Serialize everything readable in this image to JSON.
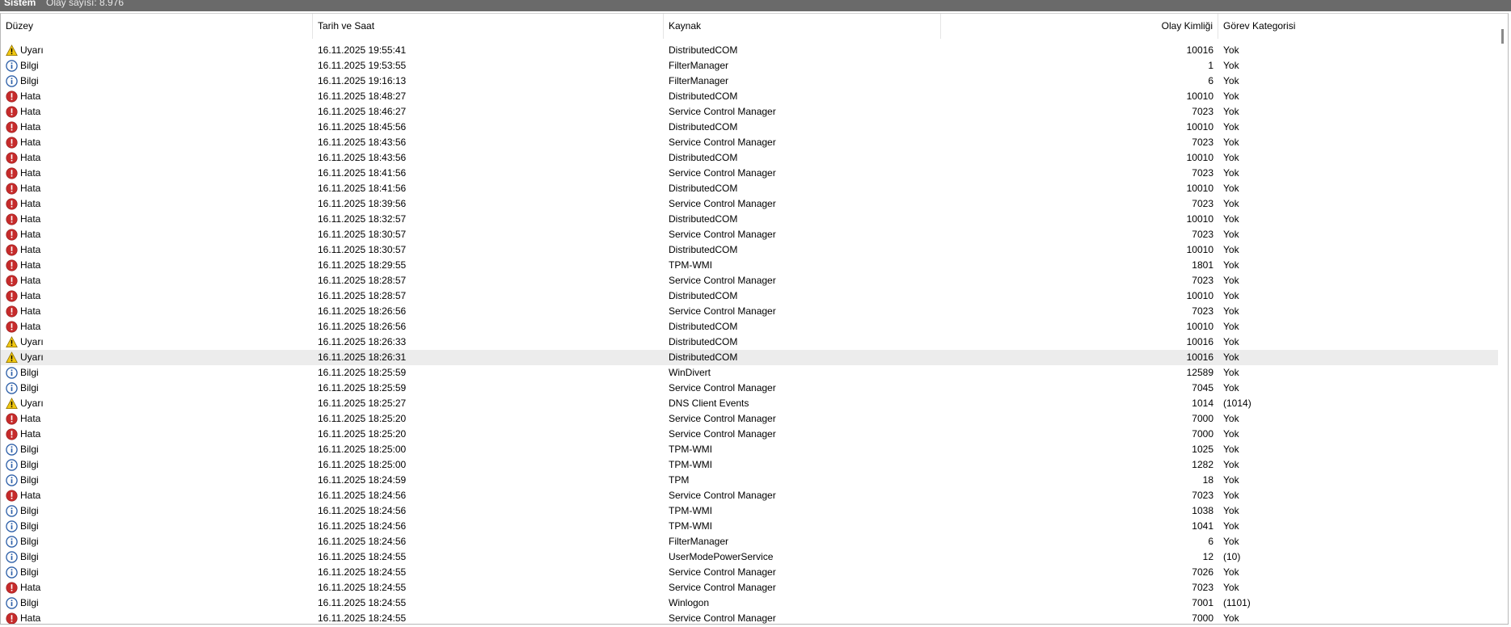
{
  "window": {
    "title": "Sistem",
    "event_count": "Olay sayısı: 8.976"
  },
  "columns": {
    "level": "Düzey",
    "datetime": "Tarih ve Saat",
    "source": "Kaynak",
    "event_id": "Olay Kimliği",
    "task_category": "Görev Kategorisi"
  },
  "level_icons": {
    "Uyarı": "warning-icon",
    "Bilgi": "info-icon",
    "Hata": "error-icon"
  },
  "colors": {
    "warning": "#f2c811",
    "info": "#2d5fa8",
    "error": "#c62b2b",
    "selected_row": "#ececec",
    "titlebar": "#6a6a6a"
  },
  "selected_row_index": 20,
  "rows": [
    {
      "level": "Uyarı",
      "datetime": "16.11.2025 19:55:41",
      "source": "DistributedCOM",
      "event_id": "10016",
      "category": "Yok"
    },
    {
      "level": "Bilgi",
      "datetime": "16.11.2025 19:53:55",
      "source": "FilterManager",
      "event_id": "1",
      "category": "Yok"
    },
    {
      "level": "Bilgi",
      "datetime": "16.11.2025 19:16:13",
      "source": "FilterManager",
      "event_id": "6",
      "category": "Yok"
    },
    {
      "level": "Hata",
      "datetime": "16.11.2025 18:48:27",
      "source": "DistributedCOM",
      "event_id": "10010",
      "category": "Yok"
    },
    {
      "level": "Hata",
      "datetime": "16.11.2025 18:46:27",
      "source": "Service Control Manager",
      "event_id": "7023",
      "category": "Yok"
    },
    {
      "level": "Hata",
      "datetime": "16.11.2025 18:45:56",
      "source": "DistributedCOM",
      "event_id": "10010",
      "category": "Yok"
    },
    {
      "level": "Hata",
      "datetime": "16.11.2025 18:43:56",
      "source": "Service Control Manager",
      "event_id": "7023",
      "category": "Yok"
    },
    {
      "level": "Hata",
      "datetime": "16.11.2025 18:43:56",
      "source": "DistributedCOM",
      "event_id": "10010",
      "category": "Yok"
    },
    {
      "level": "Hata",
      "datetime": "16.11.2025 18:41:56",
      "source": "Service Control Manager",
      "event_id": "7023",
      "category": "Yok"
    },
    {
      "level": "Hata",
      "datetime": "16.11.2025 18:41:56",
      "source": "DistributedCOM",
      "event_id": "10010",
      "category": "Yok"
    },
    {
      "level": "Hata",
      "datetime": "16.11.2025 18:39:56",
      "source": "Service Control Manager",
      "event_id": "7023",
      "category": "Yok"
    },
    {
      "level": "Hata",
      "datetime": "16.11.2025 18:32:57",
      "source": "DistributedCOM",
      "event_id": "10010",
      "category": "Yok"
    },
    {
      "level": "Hata",
      "datetime": "16.11.2025 18:30:57",
      "source": "Service Control Manager",
      "event_id": "7023",
      "category": "Yok"
    },
    {
      "level": "Hata",
      "datetime": "16.11.2025 18:30:57",
      "source": "DistributedCOM",
      "event_id": "10010",
      "category": "Yok"
    },
    {
      "level": "Hata",
      "datetime": "16.11.2025 18:29:55",
      "source": "TPM-WMI",
      "event_id": "1801",
      "category": "Yok"
    },
    {
      "level": "Hata",
      "datetime": "16.11.2025 18:28:57",
      "source": "Service Control Manager",
      "event_id": "7023",
      "category": "Yok"
    },
    {
      "level": "Hata",
      "datetime": "16.11.2025 18:28:57",
      "source": "DistributedCOM",
      "event_id": "10010",
      "category": "Yok"
    },
    {
      "level": "Hata",
      "datetime": "16.11.2025 18:26:56",
      "source": "Service Control Manager",
      "event_id": "7023",
      "category": "Yok"
    },
    {
      "level": "Hata",
      "datetime": "16.11.2025 18:26:56",
      "source": "DistributedCOM",
      "event_id": "10010",
      "category": "Yok"
    },
    {
      "level": "Uyarı",
      "datetime": "16.11.2025 18:26:33",
      "source": "DistributedCOM",
      "event_id": "10016",
      "category": "Yok"
    },
    {
      "level": "Uyarı",
      "datetime": "16.11.2025 18:26:31",
      "source": "DistributedCOM",
      "event_id": "10016",
      "category": "Yok"
    },
    {
      "level": "Bilgi",
      "datetime": "16.11.2025 18:25:59",
      "source": "WinDivert",
      "event_id": "12589",
      "category": "Yok"
    },
    {
      "level": "Bilgi",
      "datetime": "16.11.2025 18:25:59",
      "source": "Service Control Manager",
      "event_id": "7045",
      "category": "Yok"
    },
    {
      "level": "Uyarı",
      "datetime": "16.11.2025 18:25:27",
      "source": "DNS Client Events",
      "event_id": "1014",
      "category": "(1014)"
    },
    {
      "level": "Hata",
      "datetime": "16.11.2025 18:25:20",
      "source": "Service Control Manager",
      "event_id": "7000",
      "category": "Yok"
    },
    {
      "level": "Hata",
      "datetime": "16.11.2025 18:25:20",
      "source": "Service Control Manager",
      "event_id": "7000",
      "category": "Yok"
    },
    {
      "level": "Bilgi",
      "datetime": "16.11.2025 18:25:00",
      "source": "TPM-WMI",
      "event_id": "1025",
      "category": "Yok"
    },
    {
      "level": "Bilgi",
      "datetime": "16.11.2025 18:25:00",
      "source": "TPM-WMI",
      "event_id": "1282",
      "category": "Yok"
    },
    {
      "level": "Bilgi",
      "datetime": "16.11.2025 18:24:59",
      "source": "TPM",
      "event_id": "18",
      "category": "Yok"
    },
    {
      "level": "Hata",
      "datetime": "16.11.2025 18:24:56",
      "source": "Service Control Manager",
      "event_id": "7023",
      "category": "Yok"
    },
    {
      "level": "Bilgi",
      "datetime": "16.11.2025 18:24:56",
      "source": "TPM-WMI",
      "event_id": "1038",
      "category": "Yok"
    },
    {
      "level": "Bilgi",
      "datetime": "16.11.2025 18:24:56",
      "source": "TPM-WMI",
      "event_id": "1041",
      "category": "Yok"
    },
    {
      "level": "Bilgi",
      "datetime": "16.11.2025 18:24:56",
      "source": "FilterManager",
      "event_id": "6",
      "category": "Yok"
    },
    {
      "level": "Bilgi",
      "datetime": "16.11.2025 18:24:55",
      "source": "UserModePowerService",
      "event_id": "12",
      "category": "(10)"
    },
    {
      "level": "Bilgi",
      "datetime": "16.11.2025 18:24:55",
      "source": "Service Control Manager",
      "event_id": "7026",
      "category": "Yok"
    },
    {
      "level": "Hata",
      "datetime": "16.11.2025 18:24:55",
      "source": "Service Control Manager",
      "event_id": "7023",
      "category": "Yok"
    },
    {
      "level": "Bilgi",
      "datetime": "16.11.2025 18:24:55",
      "source": "Winlogon",
      "event_id": "7001",
      "category": "(1101)"
    },
    {
      "level": "Hata",
      "datetime": "16.11.2025 18:24:55",
      "source": "Service Control Manager",
      "event_id": "7000",
      "category": "Yok"
    }
  ]
}
